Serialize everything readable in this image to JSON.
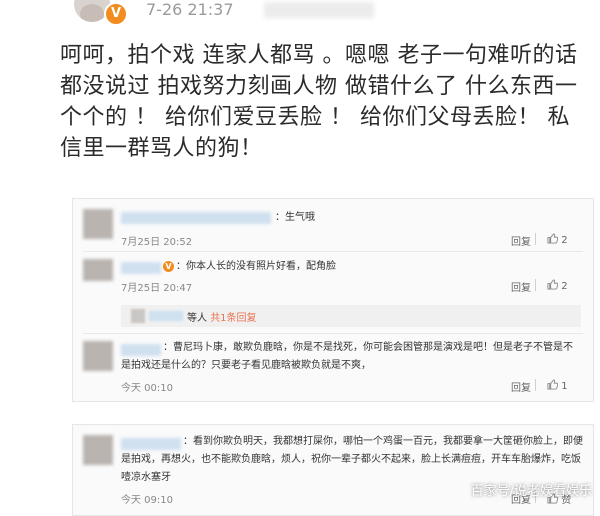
{
  "post": {
    "time": "7-26 21:37",
    "verified_badge": "V",
    "text": "呵呵，拍个戏 连家人都骂 。嗯嗯 老子一句难听的话都没说过 拍戏努力刻画人物 做错什么了 什么东西一个个的 ！ 给你们爱豆丢脸 ！ 给你们父母丢脸！ 私信里一群骂人的狗！"
  },
  "comments": [
    {
      "text": "：生气哦",
      "time": "7月25日 20:52",
      "reply_label": "回复",
      "likes": "2"
    },
    {
      "badge": "V",
      "text": "：你本人长的没有照片好看，配角脸",
      "time": "7月25日 20:47",
      "reply_label": "回复",
      "likes": "2",
      "sub_reply": {
        "prefix": "等人",
        "link": "共1条回复"
      }
    },
    {
      "text": "：曹尼玛卜康，敢欺负鹿晗，你是不是找死，你可能会困管那是演戏是吧！但是老子不管是不是拍戏还是什么的？只要老子看见鹿晗被欺负就是不爽，",
      "time": "今天 00:10",
      "reply_label": "回复",
      "likes": "1"
    }
  ],
  "bottom_comment": {
    "text": "：看到你欺负明天，我都想打屎你，哪怕一个鸡蛋一百元，我都要拿一大筐砸你脸上，即便是拍戏，再想火，也不能欺负鹿晗，烦人，祝你一辈子都火不起来，脸上长满痘痘，开车车胎爆炸，吃饭噎凉水塞牙",
    "time": "今天 09:10",
    "reply_label": "回复",
    "likes": "赞"
  },
  "watermark": "百家号/说老娱看娱乐",
  "colors": {
    "username_link": "#eb7350",
    "verified_orange": "#f28b20"
  }
}
